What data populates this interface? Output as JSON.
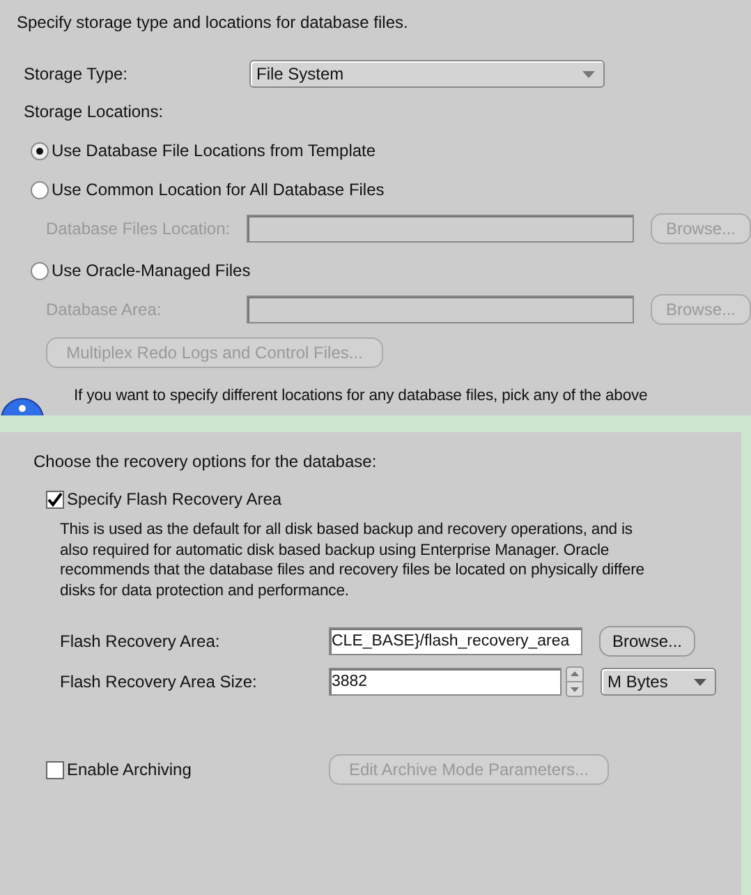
{
  "storage": {
    "intro": "Specify storage type and locations for database files.",
    "type_label": "Storage Type:",
    "type_value": "File System",
    "locations_label": "Storage Locations:",
    "options": [
      {
        "label": "Use Database File Locations from Template",
        "selected": true
      },
      {
        "label": "Use Common Location for All Database Files",
        "selected": false,
        "field": {
          "label": "Database Files Location:",
          "disabled": true,
          "button": "Browse..."
        }
      },
      {
        "label": "Use Oracle-Managed Files",
        "selected": false,
        "field": {
          "label": "Database Area:",
          "disabled": true,
          "button": "Browse..."
        }
      }
    ],
    "multiplex_button": {
      "label": "Multiplex Redo Logs and Control Files...",
      "disabled": true
    },
    "info": "If you want to specify different locations for any database files, pick any of the above"
  },
  "recovery": {
    "intro": "Choose the recovery options for the database:",
    "flash": {
      "label": "Specify Flash Recovery Area",
      "checked": true,
      "description_lines": [
        "This is used as the default for all disk based backup and recovery operations, and is",
        "also required for automatic disk based backup using Enterprise Manager. Oracle",
        "recommends that the database files and recovery files be located on physically differe",
        "disks for data protection and performance."
      ],
      "area_label": "Flash Recovery Area:",
      "area_value": "CLE_BASE}/flash_recovery_area",
      "browse": "Browse...",
      "size_label": "Flash Recovery Area Size:",
      "size_value": "3882",
      "unit": "M Bytes"
    },
    "archiving": {
      "label": "Enable Archiving",
      "checked": false,
      "button": {
        "label": "Edit Archive Mode Parameters...",
        "disabled": true
      }
    }
  }
}
